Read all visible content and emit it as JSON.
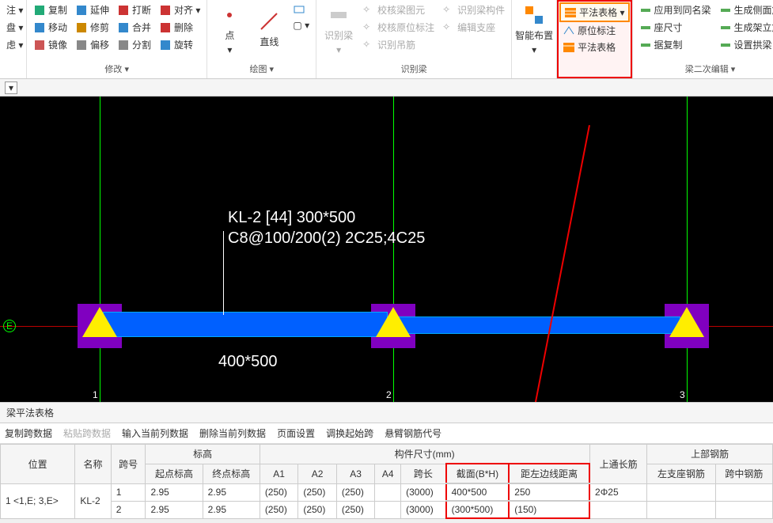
{
  "ribbon": {
    "g0": {
      "items": [
        "注 ▾",
        "盘 ▾",
        "虑 ▾"
      ]
    },
    "modify": {
      "label": "修改 ▾",
      "col1": [
        {
          "t": "复制",
          "c": "#2a7"
        },
        {
          "t": "移动",
          "c": "#38c"
        },
        {
          "t": "镜像",
          "c": "#c55"
        }
      ],
      "col2": [
        {
          "t": "延伸",
          "c": "#38c"
        },
        {
          "t": "修剪",
          "c": "#c80"
        },
        {
          "t": "偏移",
          "c": "#888"
        }
      ],
      "col3": [
        {
          "t": "打断",
          "c": "#c33"
        },
        {
          "t": "合并",
          "c": "#38c"
        },
        {
          "t": "分割",
          "c": "#888"
        }
      ],
      "col4": [
        {
          "t": "对齐 ▾",
          "c": "#c33"
        },
        {
          "t": "删除",
          "c": "#c33"
        },
        {
          "t": "旋转",
          "c": "#38c"
        }
      ]
    },
    "draw": {
      "label": "绘图 ▾",
      "point": "点",
      "line": "直线",
      "more": "▢ ▾"
    },
    "recognize": {
      "label": "识别梁",
      "big": "识别梁",
      "col1": [
        "校核梁图元",
        "校核原位标注",
        "识别吊筋"
      ],
      "col2": [
        "识别梁构件",
        "编辑支座"
      ]
    },
    "smart": {
      "label": "智能布置"
    },
    "tablegrp": {
      "t1": "平法表格 ▾",
      "t2": "原位标注",
      "t3": "平法表格"
    },
    "edit2": {
      "label": "梁二次编辑 ▾",
      "col1": [
        "应用到同名梁",
        "座尺寸",
        "据复制"
      ],
      "col2": [
        "生成侧面筋",
        "生成架立筋",
        "设置拱梁 ▾"
      ]
    }
  },
  "canvas": {
    "axis_e": "E",
    "g1": "1",
    "g2": "2",
    "g3": "3",
    "label1": "KL-2 [44] 300*500",
    "label2": "C8@100/200(2) 2C25;4C25",
    "dim": "400*500"
  },
  "panel": {
    "title": "梁平法表格",
    "toolbar": [
      "复制跨数据",
      "粘贴跨数据",
      "输入当前列数据",
      "删除当前列数据",
      "页面设置",
      "调换起始跨",
      "悬臂钢筋代号"
    ],
    "hdr": {
      "pos": "位置",
      "name": "名称",
      "span": "跨号",
      "elev": "标高",
      "start": "起点标高",
      "end": "终点标高",
      "size": "构件尺寸(mm)",
      "a1": "A1",
      "a2": "A2",
      "a3": "A3",
      "a4": "A4",
      "len": "跨长",
      "sec": "截面(B*H)",
      "dist": "距左边线距离",
      "tong": "上通长筋",
      "upper": "上部钢筋",
      "lseat": "左支座钢筋",
      "mid": "跨中钢筋"
    },
    "rows": [
      {
        "pos": "1 <1,E; 3,E>",
        "name": "KL-2",
        "span": "1",
        "start": "2.95",
        "end": "2.95",
        "a1": "(250)",
        "a2": "(250)",
        "a3": "(250)",
        "a4": "",
        "len": "(3000)",
        "sec": "400*500",
        "dist": "250",
        "tong": "2Φ25"
      },
      {
        "pos": "",
        "name": "",
        "span": "2",
        "start": "2.95",
        "end": "2.95",
        "a1": "(250)",
        "a2": "(250)",
        "a3": "(250)",
        "a4": "",
        "len": "(3000)",
        "sec": "(300*500)",
        "dist": "(150)",
        "tong": ""
      }
    ]
  }
}
